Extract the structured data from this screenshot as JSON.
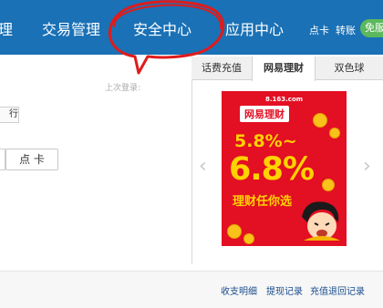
{
  "nav": {
    "items": [
      "理",
      "交易管理",
      "安全中心",
      "应用中心"
    ],
    "right_links": [
      "点卡",
      "转账"
    ],
    "badge": "免服"
  },
  "left": {
    "last_login_label": "上次登录:",
    "partial_button": "行",
    "card_button": "点 卡"
  },
  "right": {
    "tabs": [
      "话费充值",
      "网易理财",
      "双色球"
    ],
    "ad": {
      "domain": "8.163.com",
      "brand": "网易理财",
      "rate_small": "5.8%~",
      "rate_big": "6.8%",
      "slogan": "理财任你选"
    }
  },
  "bottom_links": [
    "收支明细",
    "提现记录",
    "充值退回记录"
  ],
  "colors": {
    "nav_bg": "#1a71b6",
    "annotation": "#e01b1b",
    "badge": "#5cb85c",
    "ad_bg": "#e30f23",
    "ad_text": "#ffd200"
  },
  "icons": {
    "prev": "chevron-left-icon",
    "next": "chevron-right-icon"
  }
}
